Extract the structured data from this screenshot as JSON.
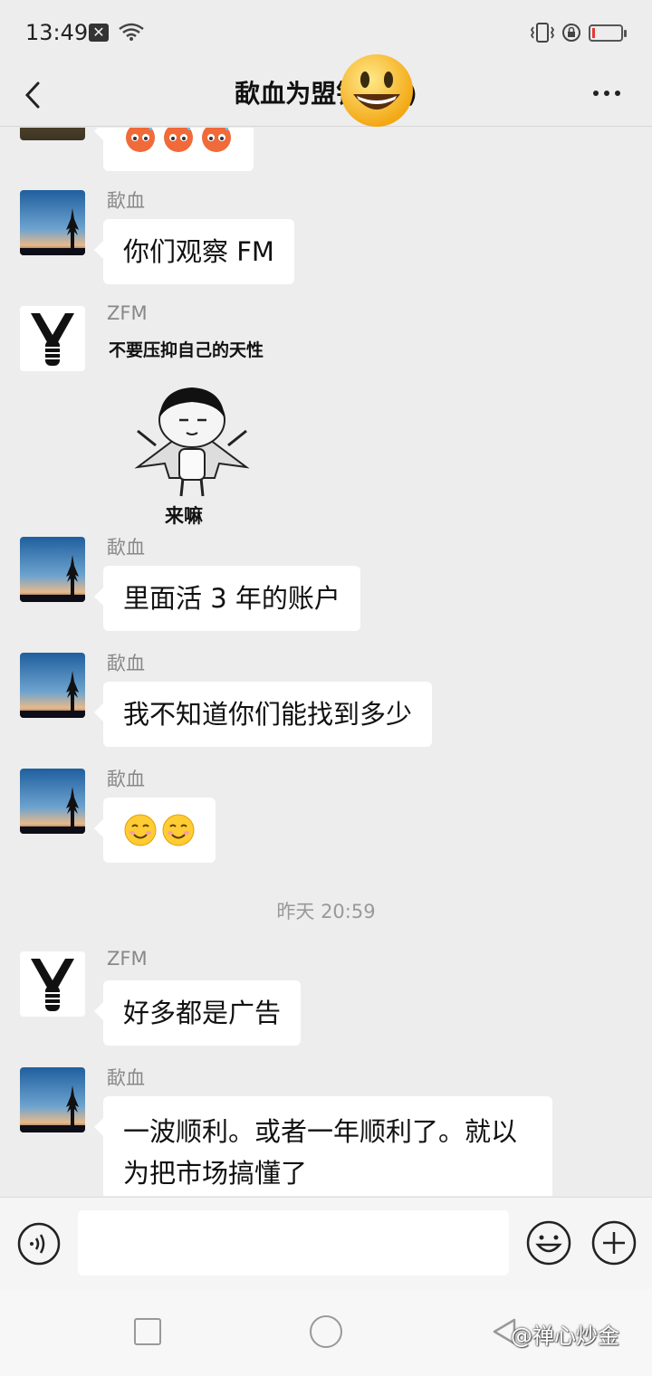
{
  "status_bar": {
    "time": "13:49",
    "notification_glyph": "✕"
  },
  "header": {
    "title": "歃血为盟铁     20)"
  },
  "messages": [
    {
      "sender": "",
      "text": "",
      "emojis": [
        "face-with-sweat",
        "face-with-sweat",
        "face-with-sweat"
      ]
    },
    {
      "sender": "歃血",
      "text": "你们观察 FM"
    },
    {
      "sender": "ZFM",
      "sticker_caption_top": "不要压抑自己的天性",
      "sticker_caption_bottom": "来嘛"
    },
    {
      "sender": "歃血",
      "text": "里面活 3 年的账户"
    },
    {
      "sender": "歃血",
      "text": "我不知道你们能找到多少"
    },
    {
      "sender": "歃血",
      "emojis": [
        "smiling-face",
        "smiling-face"
      ]
    },
    {
      "sender": "ZFM",
      "text": "好多都是广告"
    },
    {
      "sender": "歃血",
      "text": "一波顺利。或者一年顺利了。就以为把市场搞懂了"
    }
  ],
  "timestamp": "昨天 20:59",
  "input": {
    "value": "",
    "placeholder": ""
  },
  "watermark": "@禅心炒金",
  "colors": {
    "background": "#ededed",
    "bubble": "#ffffff",
    "battery_low": "#e53935"
  }
}
